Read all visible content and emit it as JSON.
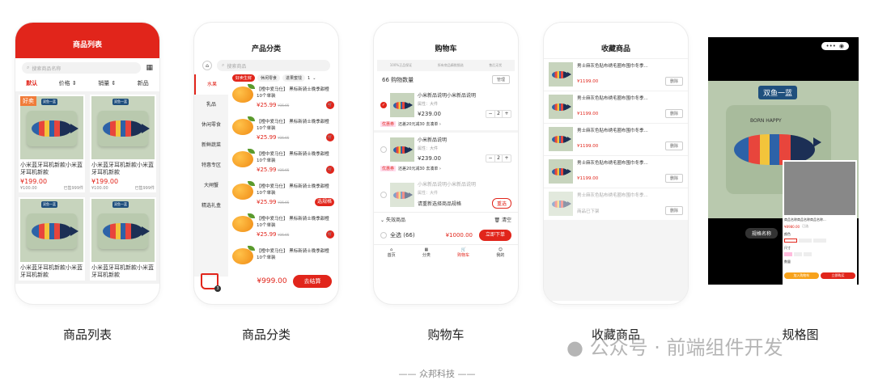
{
  "captions": [
    "商品列表",
    "商品分类",
    "购物车",
    "收藏商品",
    "规格图"
  ],
  "footer": "—— 众邦科技 ——",
  "watermark": "公众号 · 前端组件开发",
  "list": {
    "title": "商品列表",
    "search_placeholder": "搜索商品名称",
    "sorts": [
      "默认",
      "价格",
      "销量",
      "新品"
    ],
    "hot_badge": "好卖",
    "shop_tag": "双鱼一蓝",
    "items": [
      {
        "name": "小米蓝牙耳机新款小米蓝牙耳机新款",
        "price": "¥199.00",
        "orig": "¥100.00",
        "sold": "已售999件"
      },
      {
        "name": "小米蓝牙耳机新款小米蓝牙耳机新款",
        "price": "¥199.00",
        "orig": "¥100.00",
        "sold": "已售999件"
      },
      {
        "name": "小米蓝牙耳机新款小米蓝牙耳机新款",
        "price": "",
        "orig": "",
        "sold": ""
      },
      {
        "name": "小米蓝牙耳机新款小米蓝牙耳机新款",
        "price": "",
        "orig": "",
        "sold": ""
      }
    ]
  },
  "category": {
    "title": "产品分类",
    "search_placeholder": "搜索商品",
    "side": [
      "水果",
      "乳品",
      "休闲零食",
      "新鲜蔬菜",
      "特惠专区",
      "大闸蟹",
      "精选礼盒"
    ],
    "chips": [
      "好卖生鲜",
      "休闲零食",
      "进果蜜饯"
    ],
    "chip_more": "1",
    "items": [
      {
        "name": "【橙中爱马仕】 黑标新骑士晚季甜橙10个单装",
        "price": "¥25.99",
        "orig": "¥35.65",
        "action": "icon"
      },
      {
        "name": "【橙中爱马仕】 黑标新骑士晚季甜橙10个单装",
        "price": "¥25.99",
        "orig": "¥35.65",
        "action": "icon"
      },
      {
        "name": "【橙中爱马仕】 黑标新骑士晚季甜橙10个单装",
        "price": "¥25.99",
        "orig": "¥35.65",
        "action": "icon"
      },
      {
        "name": "【橙中爱马仕】 黑标新骑士晚季甜橙10个单装",
        "price": "¥25.99",
        "orig": "¥35.65",
        "action": "选规格"
      },
      {
        "name": "【橙中爱马仕】 黑标新骑士晚季甜橙10个单装",
        "price": "¥25.99",
        "orig": "¥35.65",
        "action": "icon"
      },
      {
        "name": "【橙中爱马仕】 黑标新骑士晚季甜橙10个单装",
        "price": "",
        "orig": "",
        "action": ""
      }
    ],
    "cart_total": "¥999.00",
    "checkout": "去结算",
    "cart_count": "3"
  },
  "cart": {
    "title": "购物车",
    "guarantees": [
      "100%正品保证",
      "所有商品精挑细选",
      "售后无忧"
    ],
    "count_label": "66 购物数量",
    "manage": "管理",
    "items": [
      {
        "name": "小米新品说明小米新品说明",
        "attr": "属性：大件",
        "price": "¥239.00",
        "qty": "2",
        "promo_tag": "优惠券",
        "promo": "还差20元减30  去凑单 ›"
      },
      {
        "name": "小米新品说明",
        "attr": "属性：大件",
        "price": "¥239.00",
        "qty": "2",
        "promo_tag": "优惠券",
        "promo": "还差20元减30  去凑单 ›"
      }
    ],
    "invalid_item": {
      "name": "小米新品说明小米新品说明",
      "attr": "属性：大件",
      "note": "请重新选择商品规格",
      "reselect": "重选"
    },
    "invalid_label": "失效商品",
    "clear": "清空",
    "select_all": "全选 (66)",
    "total": "¥1000.00",
    "order": "立即下单",
    "tabs": [
      "首页",
      "分类",
      "购物车",
      "我的"
    ]
  },
  "fav": {
    "title": "收藏商品",
    "name": "男士麻灰色贴布绣毛圈布围巾冬季...",
    "price": "¥1199.00",
    "delete": "删除",
    "offline": "商品已下架"
  },
  "spec": {
    "overlay": "双鱼一蓝",
    "pillow_text": "BORN  HAPPY",
    "spec_btn": "规格名称",
    "sheet": {
      "name": "商品名称商品名称商品名称...",
      "price": "¥8980.00",
      "tag": "已选",
      "labels": [
        "颜色",
        "尺寸",
        "数量"
      ],
      "add": "加入购物车",
      "buy": "立即购买"
    }
  }
}
